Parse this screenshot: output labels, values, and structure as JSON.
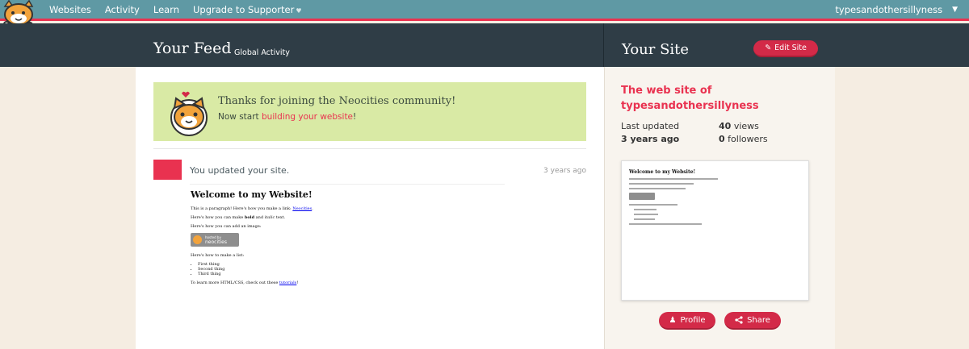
{
  "nav": {
    "items": [
      "Websites",
      "Activity",
      "Learn",
      "Upgrade to Supporter"
    ],
    "username": "typesandothersillyness"
  },
  "header": {
    "feed_title": "Your Feed",
    "global_activity": "Global Activity",
    "site_title": "Your Site",
    "edit_site": "Edit Site"
  },
  "welcome": {
    "thanks": "Thanks for joining the Neocities community!",
    "start_prefix": "Now start ",
    "start_link": "building your website",
    "start_suffix": "!"
  },
  "event": {
    "message": "You updated your site.",
    "time": "3 years ago"
  },
  "screenshot": {
    "heading": "Welcome to my Website!",
    "p1_prefix": "This is a paragraph! Here's how you make a link: ",
    "p1_link": "Neocities",
    "p1_suffix": ".",
    "p2_prefix": "Here's how you can make ",
    "p2_bold": "bold",
    "p2_mid": " and ",
    "p2_italic": "italic",
    "p2_suffix": " text.",
    "p3": "Here's how you can add an image:",
    "hosted_small": "hosted by",
    "hosted_name": "neocities",
    "p4": "Here's how to make a list:",
    "list": [
      "First thing",
      "Second thing",
      "Third thing"
    ],
    "p5_prefix": "To learn more HTML/CSS, check out these ",
    "p5_link": "tutorials",
    "p5_suffix": "!"
  },
  "site": {
    "name": "The web site of typesandothersillyness",
    "last_updated_label": "Last updated",
    "last_updated_value": "3 years ago",
    "views_count": "40",
    "views_label": "views",
    "followers_count": "0",
    "followers_label": "followers",
    "profile_button": "Profile",
    "share_button": "Share"
  },
  "colors": {
    "accent": "#e93250",
    "nav_bg": "#5f99a4",
    "header_bg": "#2f3d46",
    "welcome_bg": "#d9eaa5"
  }
}
